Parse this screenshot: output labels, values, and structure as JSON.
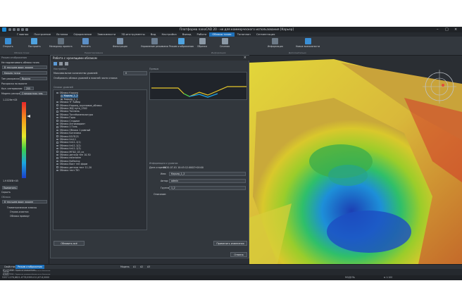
{
  "window": {
    "title": "Платформа nanoCAD 20 - не для коммерческого использования [Карьер]"
  },
  "menu": {
    "tabs": [
      "Главная",
      "Построение",
      "Вставка",
      "Оформление",
      "Зависимости",
      "3D-инструменты",
      "Вид",
      "Настройка",
      "Вывод",
      "Работа",
      "Облака точек",
      "Топоплан",
      "Сегментация"
    ],
    "active_index": 10
  },
  "ribbon": {
    "buttons": [
      "Открыть",
      "Построить",
      "Менеджер проекта",
      "Вписать",
      "Фильтрация",
      "Управление режимами",
      "Режим отображения",
      "Обрезка",
      "Сечения",
      "Информация",
      "Новые возможности"
    ],
    "groups": [
      "Облака точек",
      "Редактирование",
      "Информация",
      "Дополнительно"
    ]
  },
  "left_panel": {
    "title": "Режим отображения",
    "items": [
      "Не подсвечивать облако точек",
      "В текущем виде: экране",
      "Карьер точки",
      "Тип раскраски:",
      "Раскраска по высоте",
      "Кол. интервалов:",
      "Модель раскраски",
      "Применить",
      "Скрыть",
      "Облака",
      "В текущем виде: экране",
      "Геометрические классы",
      "Отраж.очистка",
      "Облака прямоуг"
    ],
    "type_value": "Высота",
    "intervals": "255",
    "model_value": "Стандартная тем.",
    "scale_max": "1.2229e+05",
    "scale_min": "1.9 ВЗЕВ+05"
  },
  "dialog": {
    "title": "Работа с хранящими облаком",
    "settings_label": "Настройки",
    "max_points_label": "Максимальное количество уровней:",
    "max_points_value": "0",
    "show_levels_label": "Отобразить облака уровней в нижней части списка",
    "list_label": "Список уровней",
    "preview_label": "Превью",
    "info_label": "Информация о уровнях",
    "date_label": "Дата и время:",
    "date_value": "2020-07-01 10:45:12.000Z+00:00",
    "name_label": "Имя:",
    "name_value": "Карьер_1_2",
    "author_label": "Автор:",
    "author_value": "admin",
    "group_label": "Группа:",
    "group_value": "1_2",
    "comment_label": "Описание:",
    "update_all_button": "Обновить всё",
    "apply_changes_button": "Применить изменения",
    "ok_button": "Отмена",
    "tree": [
      {
        "label": "Облако Карьер",
        "level": 0
      },
      {
        "label": "Карьер_1_2",
        "level": 1,
        "selected": true
      },
      {
        "label": "Карьер_1_1",
        "level": 1
      },
      {
        "label": "Облака ТГ Кибер",
        "level": 0
      },
      {
        "label": "Облако Карьер_групповое_облако",
        "level": 0
      },
      {
        "label": "Облако ЖД пути_1302",
        "level": 0
      },
      {
        "label": "Облако Тоннель",
        "level": 0
      },
      {
        "label": "Облако ТоннНоменклатура",
        "level": 0
      },
      {
        "label": "Облако Горы",
        "level": 0
      },
      {
        "label": "Облако Стадион",
        "level": 0
      },
      {
        "label": "Облако Антиквариат",
        "level": 0
      },
      {
        "label": "Облако 1 Гиль",
        "level": 0
      },
      {
        "label": "Облако Облако 1 ровный",
        "level": 0
      },
      {
        "label": "Облако Ботаника",
        "level": 0
      },
      {
        "label": "Облако БОЛ121",
        "level": 0
      },
      {
        "label": "Облако tin4.1",
        "level": 0
      },
      {
        "label": "Облако tin11.1(1)",
        "level": 0
      },
      {
        "label": "Облако tin11.1(2)",
        "level": 0
      },
      {
        "label": "Облако tin11.1(3)",
        "level": 0
      },
      {
        "label": "Облако МП02_03_xx",
        "level": 0
      },
      {
        "label": "Облако детали тен 10.30",
        "level": 0
      },
      {
        "label": "Облако exteriahm",
        "level": 0
      },
      {
        "label": "Облако NoFacing",
        "level": 0
      },
      {
        "label": "Облако Вист тен форм",
        "level": 0
      },
      {
        "label": "Облако детали тест 11.20",
        "level": 0
      },
      {
        "label": "Облако тест.ТЮ",
        "level": 0
      }
    ]
  },
  "bottom_tabs": [
    "Свойства",
    "Режим отображения",
    "Модель",
    "A1",
    "A2",
    "A3"
  ],
  "command_lines": [
    "NPC_CLOP_МОДЕ -- Отмена: последняя действия",
    "PC_EDIT_ZTEKEH -- Управление режимами облаков точек в Заполнение",
    "*Отмена*",
    "*Отмена*",
    "*Отмена*",
    "PC_EDIT_ZTEKEH -- Управление режимами облаков точек в Заполнение",
    "Команда:"
  ],
  "status": {
    "coords": "5337.1278,6621.4778,9395.011,67.8,0000",
    "mode": "МОДЕЛЬ",
    "scale": "м 1:100"
  }
}
